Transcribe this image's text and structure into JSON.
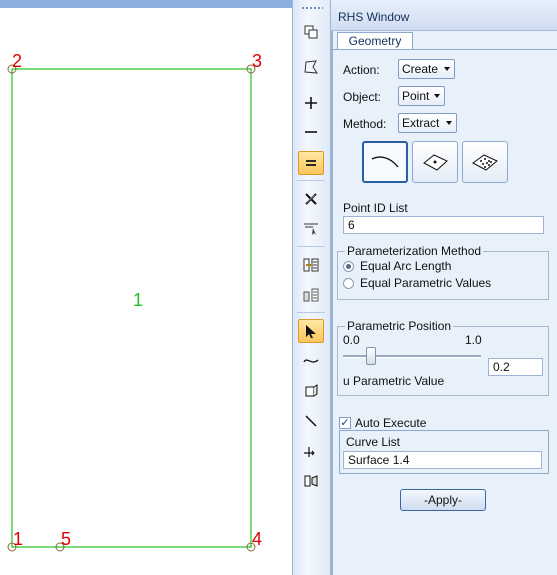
{
  "viewport": {
    "vertex_labels": [
      "2",
      "3",
      "1",
      "5",
      "4"
    ],
    "surface_label": "1",
    "colors": {
      "edge": "#22c322",
      "vertex_label": "#e00000"
    }
  },
  "toolbar": {
    "icons": [
      "copy-icon",
      "lasso-icon",
      "plus-icon",
      "minus-icon",
      "equal-icon",
      "delete-x-icon",
      "filter-icon",
      "transfer-icon",
      "transfer-alt-icon",
      "select-arrow-icon",
      "curve-icon",
      "solid-icon",
      "line-icon",
      "move-icon",
      "mirror-icon"
    ]
  },
  "panel": {
    "title": "RHS Window",
    "tab": "Geometry",
    "action_label": "Action:",
    "action_value": "Create",
    "object_label": "Object:",
    "object_value": "Point",
    "method_label": "Method:",
    "method_value": "Extract",
    "point_id_label": "Point ID List",
    "point_id_value": "6",
    "param_method": {
      "legend": "Parameterization Method",
      "options": [
        "Equal Arc Length",
        "Equal Parametric Values"
      ],
      "selected": 0
    },
    "param_position": {
      "legend": "Parametric Position",
      "min_label": "0.0",
      "max_label": "1.0",
      "u_label": "u Parametric Value",
      "u_value": "0.2",
      "slider_fraction": 0.2
    },
    "auto_execute_label": "Auto Execute",
    "auto_execute_checked": true,
    "curve_list_label": "Curve List",
    "curve_list_value": "Surface 1.4",
    "apply_label": "-Apply-"
  }
}
